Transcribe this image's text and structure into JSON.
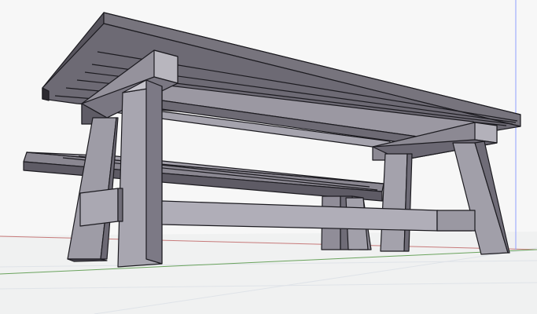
{
  "model": {
    "name": "",
    "objects": [
      "tabletop",
      "leg",
      "apron",
      "stretcher",
      "bench"
    ]
  },
  "colors": {
    "background": "#f7f7f7",
    "ground": "#f0f1f1",
    "axis_red": "#c77a7a",
    "axis_green": "#6aa35d",
    "axis_blue": "#8f9fff",
    "face_light": "#b6b4bc",
    "face_mid": "#8f8c97",
    "face_dark": "#4d4a55",
    "edge": "#1c1b20"
  }
}
